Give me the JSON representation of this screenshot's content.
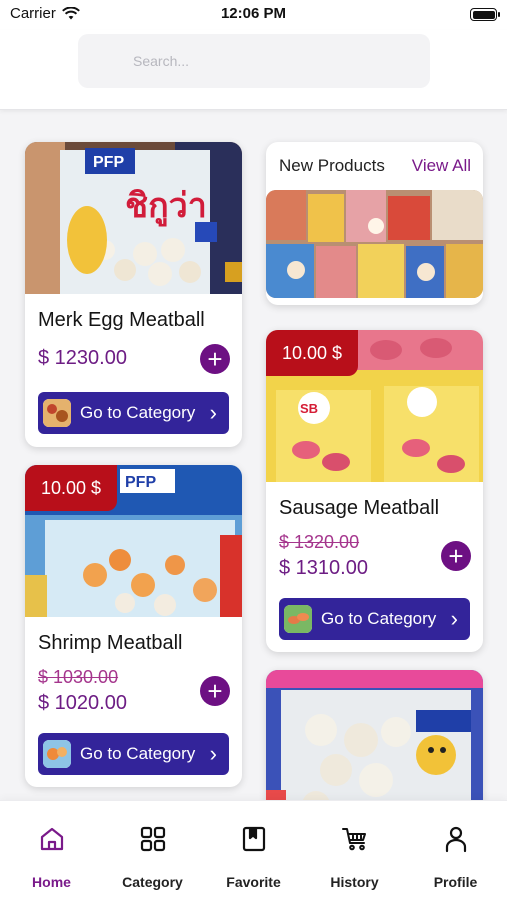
{
  "status_bar": {
    "carrier": "Carrier",
    "time": "12:06 PM"
  },
  "search": {
    "placeholder": "Search..."
  },
  "new_products": {
    "title": "New Products",
    "view_all": "View All"
  },
  "products": [
    {
      "name": "Merk Egg Meatball",
      "price": "$ 1230.00",
      "category_button": "Go to Category"
    },
    {
      "name": "Shrimp Meatball",
      "badge": "10.00 $",
      "old_price": "$ 1030.00",
      "price": "$ 1020.00",
      "category_button": "Go to Category"
    },
    {
      "name": "Sausage Meatball",
      "badge": "10.00 $",
      "old_price": "$ 1320.00",
      "price": "$ 1310.00",
      "category_button": "Go to Category"
    }
  ],
  "image_text": {
    "merk_brand": "PFP",
    "merk_thai": "ชิกูว่า",
    "shrimp_brand": "PFP",
    "sausage_brand": "SB"
  },
  "tabs": [
    {
      "label": "Home",
      "icon": "home-icon",
      "active": true
    },
    {
      "label": "Category",
      "icon": "grid-icon"
    },
    {
      "label": "Favorite",
      "icon": "bookmark-icon"
    },
    {
      "label": "History",
      "icon": "cart-icon"
    },
    {
      "label": "Profile",
      "icon": "person-icon"
    }
  ],
  "colors": {
    "accent": "#7a1a8a",
    "price": "#6d1d84",
    "badge": "#b80f1a",
    "category_button": "#33249a"
  }
}
